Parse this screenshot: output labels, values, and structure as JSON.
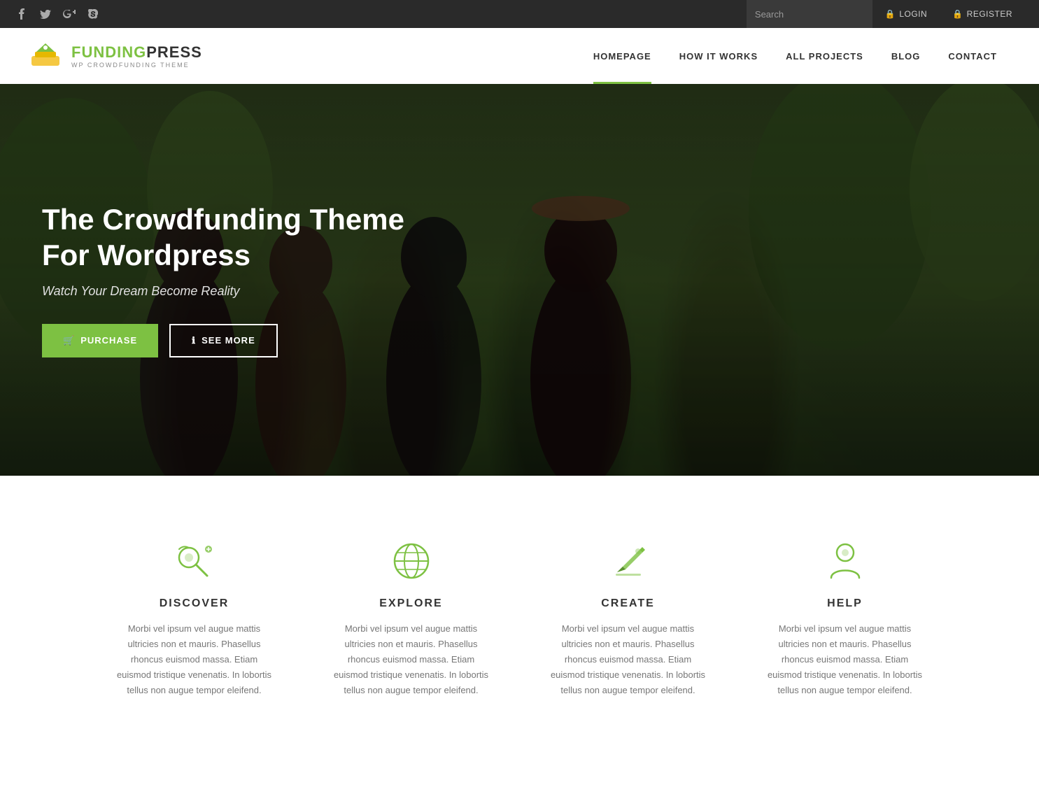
{
  "topbar": {
    "social": [
      {
        "name": "facebook",
        "symbol": "f"
      },
      {
        "name": "twitter",
        "symbol": "t"
      },
      {
        "name": "google-plus",
        "symbol": "g+"
      },
      {
        "name": "skype",
        "symbol": "s"
      }
    ],
    "search_placeholder": "Search",
    "login_label": "LOGIN",
    "register_label": "REGISTER"
  },
  "navbar": {
    "logo_funding": "FUNDING",
    "logo_press": "PRESS",
    "logo_sub": "WP CROWDFUNDING THEME",
    "links": [
      {
        "label": "HOMEPAGE",
        "active": true
      },
      {
        "label": "HOW IT WORKS",
        "active": false
      },
      {
        "label": "ALL PROJECTS",
        "active": false
      },
      {
        "label": "BLOG",
        "active": false
      },
      {
        "label": "CONTACT",
        "active": false
      }
    ]
  },
  "hero": {
    "title": "The Crowdfunding Theme For Wordpress",
    "subtitle": "Watch Your Dream Become Reality",
    "purchase_label": "PURCHASE",
    "seemore_label": "SEE MORE"
  },
  "features": [
    {
      "id": "discover",
      "title": "DISCOVER",
      "desc": "Morbi vel ipsum vel augue mattis ultricies non et mauris. Phasellus rhoncus euismod massa. Etiam euismod tristique venenatis. In lobortis tellus non augue tempor eleifend."
    },
    {
      "id": "explore",
      "title": "EXPLORE",
      "desc": "Morbi vel ipsum vel augue mattis ultricies non et mauris. Phasellus rhoncus euismod massa. Etiam euismod tristique venenatis. In lobortis tellus non augue tempor eleifend."
    },
    {
      "id": "create",
      "title": "CREATE",
      "desc": "Morbi vel ipsum vel augue mattis ultricies non et mauris. Phasellus rhoncus euismod massa. Etiam euismod tristique venenatis. In lobortis tellus non augue tempor eleifend."
    },
    {
      "id": "help",
      "title": "HELP",
      "desc": "Morbi vel ipsum vel augue mattis ultricies non et mauris. Phasellus rhoncus euismod massa. Etiam euismod tristique venenatis. In lobortis tellus non augue tempor eleifend."
    }
  ],
  "colors": {
    "green": "#7dc142",
    "dark": "#2a2a2a",
    "text": "#333"
  }
}
